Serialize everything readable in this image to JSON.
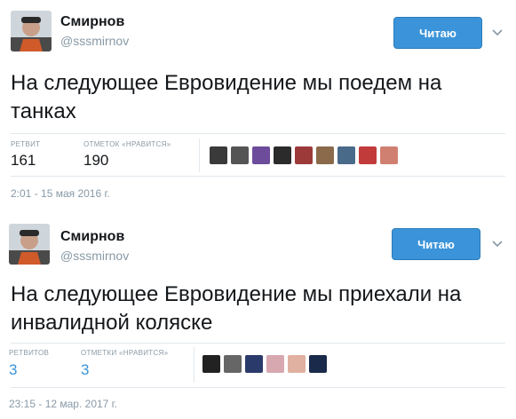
{
  "tweets": [
    {
      "name": "Смирнов",
      "handle": "@sssmirnov",
      "follow_label": "Читаю",
      "text_lines": [
        "На следующее Евровидение мы поедем на",
        "танках"
      ],
      "retweets_label": "РЕТВИТ",
      "retweets_count": "161",
      "likes_label": "ОТМЕТОК «НРАВИТСЯ»",
      "likes_count": "190",
      "timestamp": "2:01 - 15 мая 2016 г.",
      "liker_colors": [
        "#3a3a3a",
        "#555555",
        "#6d4c9c",
        "#2b2b2b",
        "#9c3a3a",
        "#8a6a4a",
        "#4a6a8a",
        "#c23b3b",
        "#d08070"
      ]
    },
    {
      "name": "Смирнов",
      "handle": "@sssmirnov",
      "follow_label": "Читаю",
      "text_lines": [
        "На следующее Евровидение мы приехали на",
        "инвалидной коляске"
      ],
      "retweets_label": "РЕТВИТОВ",
      "retweets_count": "3",
      "likes_label": "ОТМЕТКИ «НРАВИТСЯ»",
      "likes_count": "3",
      "timestamp": "23:15 - 12 мар. 2017 г.",
      "liker_colors": [
        "#222222",
        "#666666",
        "#2a3a6a",
        "#d8a8b0",
        "#e0b0a0",
        "#1a2a4a"
      ]
    }
  ],
  "colors": {
    "accent": "#3b94d9",
    "muted": "#8899a6",
    "text": "#14171a",
    "border": "#e1e8ed"
  },
  "icons": {
    "chevron": "chevron-down-icon"
  }
}
